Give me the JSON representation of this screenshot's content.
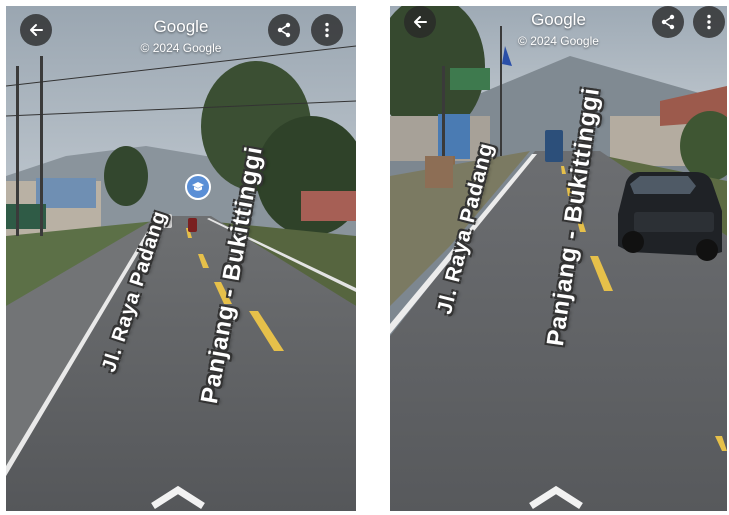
{
  "left_view": {
    "title": "Google",
    "copyright": "© 2024 Google",
    "road_line1": "Jl. Raya Padang",
    "road_line2": "Panjang - Bukittinggi",
    "icons": [
      "back-arrow-icon",
      "share-icon",
      "more-vert-icon",
      "school-marker-icon",
      "chevron-up-icon"
    ]
  },
  "right_view": {
    "title": "Google",
    "copyright": "© 2024 Google",
    "road_line1": "Jl. Raya Padang",
    "road_line2": "Panjang - Bukittinggi",
    "icons": [
      "back-arrow-icon",
      "share-icon",
      "more-vert-icon",
      "chevron-up-icon"
    ]
  },
  "colors": {
    "button_bg": "#282828",
    "road": "#5f6164",
    "lane_marking": "#e6c04a",
    "edge_line": "#f2f2f2",
    "sky": "#aeb8c2",
    "vegetation": "#3f5a34"
  }
}
